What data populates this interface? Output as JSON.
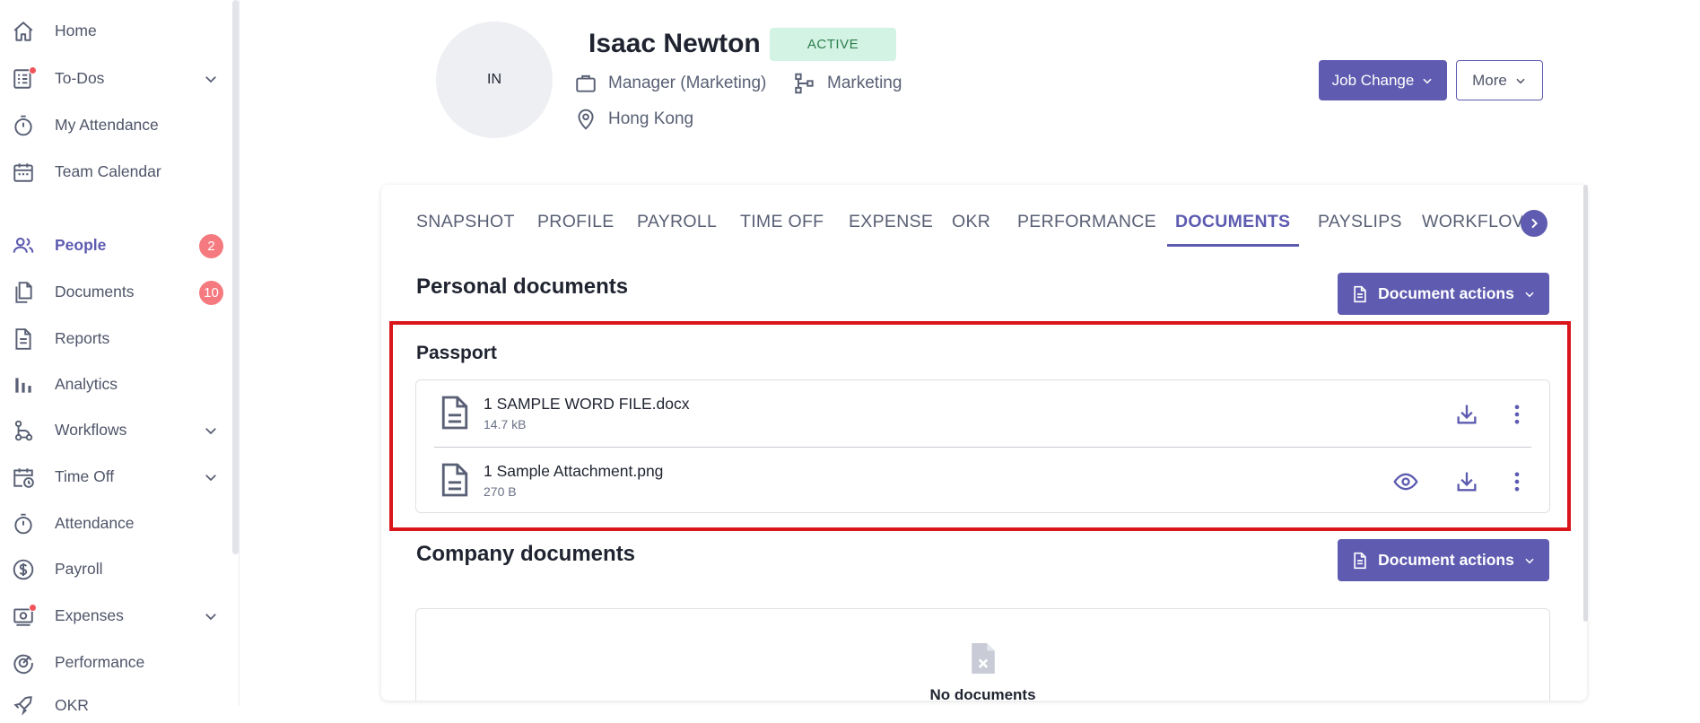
{
  "sidebar": {
    "items": [
      {
        "label": "Home",
        "icon": "home-icon"
      },
      {
        "label": "To-Dos",
        "icon": "checklist-icon"
      },
      {
        "label": "My Attendance",
        "icon": "stopwatch-icon"
      },
      {
        "label": "Team Calendar",
        "icon": "calendar-icon"
      },
      {
        "label": "People",
        "icon": "people-icon",
        "badge": "2"
      },
      {
        "label": "Documents",
        "icon": "documents-icon",
        "badge": "10"
      },
      {
        "label": "Reports",
        "icon": "report-icon"
      },
      {
        "label": "Analytics",
        "icon": "bar-chart-icon"
      },
      {
        "label": "Workflows",
        "icon": "workflow-icon"
      },
      {
        "label": "Time Off",
        "icon": "calendar-clock-icon"
      },
      {
        "label": "Attendance",
        "icon": "stopwatch-icon"
      },
      {
        "label": "Payroll",
        "icon": "dollar-circle-icon"
      },
      {
        "label": "Expenses",
        "icon": "receipt-icon"
      },
      {
        "label": "Performance",
        "icon": "gauge-icon"
      },
      {
        "label": "OKR",
        "icon": "rocket-icon"
      }
    ]
  },
  "employee": {
    "initials": "IN",
    "name": "Isaac Newton",
    "status": "ACTIVE",
    "title": "Manager (Marketing)",
    "department": "Marketing",
    "location": "Hong Kong"
  },
  "actions": {
    "job_change": "Job Change",
    "more": "More"
  },
  "tabs": [
    {
      "label": "SNAPSHOT"
    },
    {
      "label": "PROFILE"
    },
    {
      "label": "PAYROLL"
    },
    {
      "label": "TIME OFF"
    },
    {
      "label": "EXPENSE"
    },
    {
      "label": "OKR"
    },
    {
      "label": "PERFORMANCE"
    },
    {
      "label": "DOCUMENTS",
      "active": true
    },
    {
      "label": "PAYSLIPS"
    },
    {
      "label": "WORKFLOV"
    }
  ],
  "personal": {
    "title": "Personal documents",
    "actions_label": "Document actions",
    "group": "Passport",
    "files": [
      {
        "name": "1 SAMPLE WORD FILE.docx",
        "size": "14.7 kB"
      },
      {
        "name": "1 Sample Attachment.png",
        "size": "270 B"
      }
    ]
  },
  "company": {
    "title": "Company documents",
    "actions_label": "Document actions",
    "empty_text": "No documents"
  },
  "colors": {
    "accent": "#5e5bb0",
    "badge": "#f57a7f",
    "active_badge_bg": "#d3f3e4",
    "highlight": "#d8161b"
  }
}
